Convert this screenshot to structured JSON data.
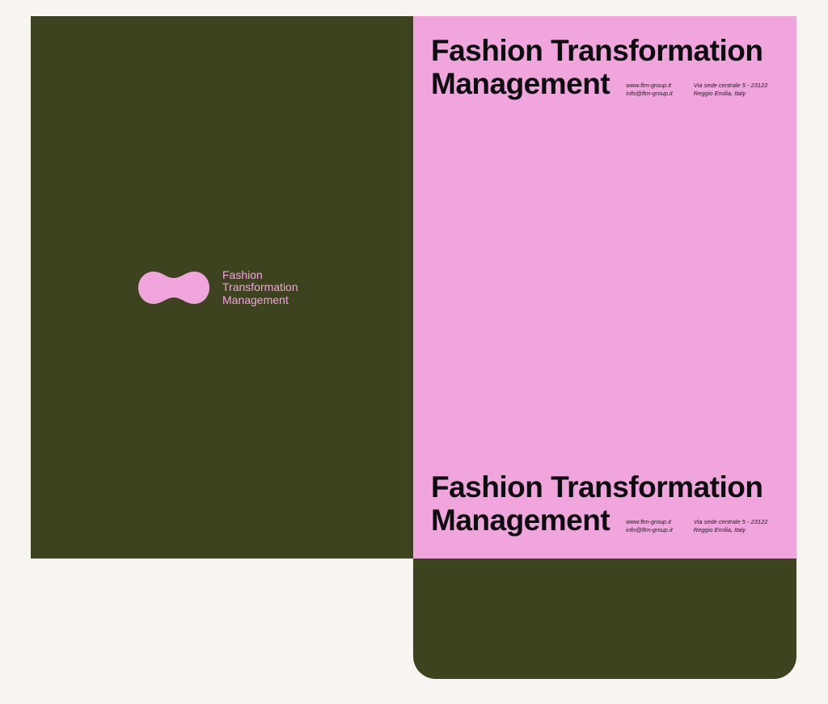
{
  "brand": {
    "logo_lines": [
      "Fashion",
      "Transformation",
      "Management"
    ]
  },
  "title": {
    "line1": "Fashion Transformation",
    "line2": "Management"
  },
  "contact": {
    "website": "www.ftm-group.it",
    "email": "info@ftm-group.it",
    "address_line1": "Via sede centrale 5 - 23122",
    "address_line2": "Reggio Emilia, Italy"
  },
  "colors": {
    "olive": "#3d431f",
    "pink": "#f0a6dc",
    "background": "#f7f4f1",
    "text": "#0d0d10"
  }
}
